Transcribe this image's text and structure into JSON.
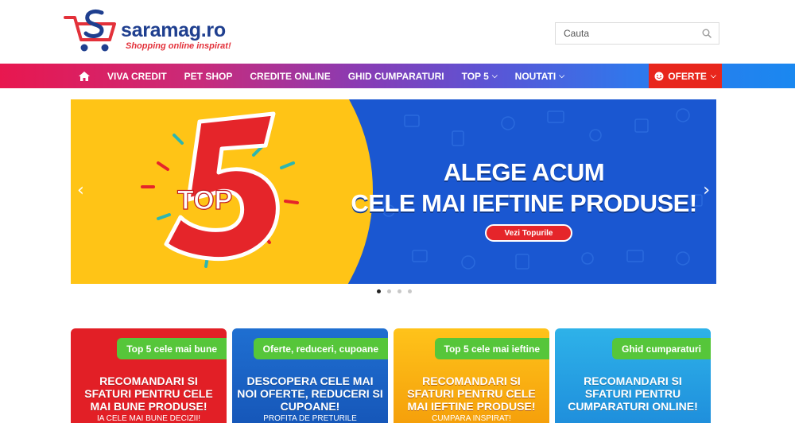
{
  "logo": {
    "name": "saramag.ro",
    "tagline": "Shopping online inspirat!"
  },
  "search": {
    "placeholder": "Cauta"
  },
  "nav": {
    "items": [
      {
        "label": "VIVA CREDIT"
      },
      {
        "label": "PET SHOP"
      },
      {
        "label": "CREDITE ONLINE"
      },
      {
        "label": "GHID CUMPARATURI"
      },
      {
        "label": "TOP 5",
        "dropdown": true
      },
      {
        "label": "NOUTATI",
        "dropdown": true
      }
    ],
    "oferte": "OFERTE"
  },
  "slider": {
    "badge_top": "TOP",
    "badge_number": "5",
    "headline_line1": "ALEGE ACUM",
    "headline_line2": "CELE MAI IEFTINE PRODUSE!",
    "button": "Vezi Topurile",
    "slide_count": 4,
    "active_slide": 1
  },
  "cards": [
    {
      "badge": "Top 5 cele mai bune",
      "title": "RECOMANDARI SI SFATURI PENTRU CELE MAI BUNE PRODUSE!",
      "sub": "IA CELE MAI BUNE DECIZII!"
    },
    {
      "badge": "Oferte, reduceri, cupoane",
      "title": "DESCOPERA CELE MAI NOI OFERTE, REDUCERI SI CUPOANE!",
      "sub": "PROFITA DE PRETURILE"
    },
    {
      "badge": "Top 5 cele mai ieftine",
      "title": "RECOMANDARI SI SFATURI PENTRU CELE MAI IEFTINE PRODUSE!",
      "sub": "CUMPARA INSPIRAT!"
    },
    {
      "badge": "Ghid cumparaturi",
      "title": "RECOMANDARI SI SFATURI PENTRU CUMPARATURI ONLINE!",
      "sub": ""
    }
  ],
  "colors": {
    "brand_blue": "#1f3f8f",
    "brand_red": "#e3313a",
    "oferte_red": "#e8261c",
    "badge_green": "#56c63a",
    "slider_blue": "#1a57d1",
    "slider_yellow": "#ffc416"
  },
  "icons": [
    "home-icon",
    "search-icon",
    "chevron-down-icon",
    "emoji-icon",
    "chevron-left-icon",
    "chevron-right-icon",
    "cart-logo-icon"
  ]
}
